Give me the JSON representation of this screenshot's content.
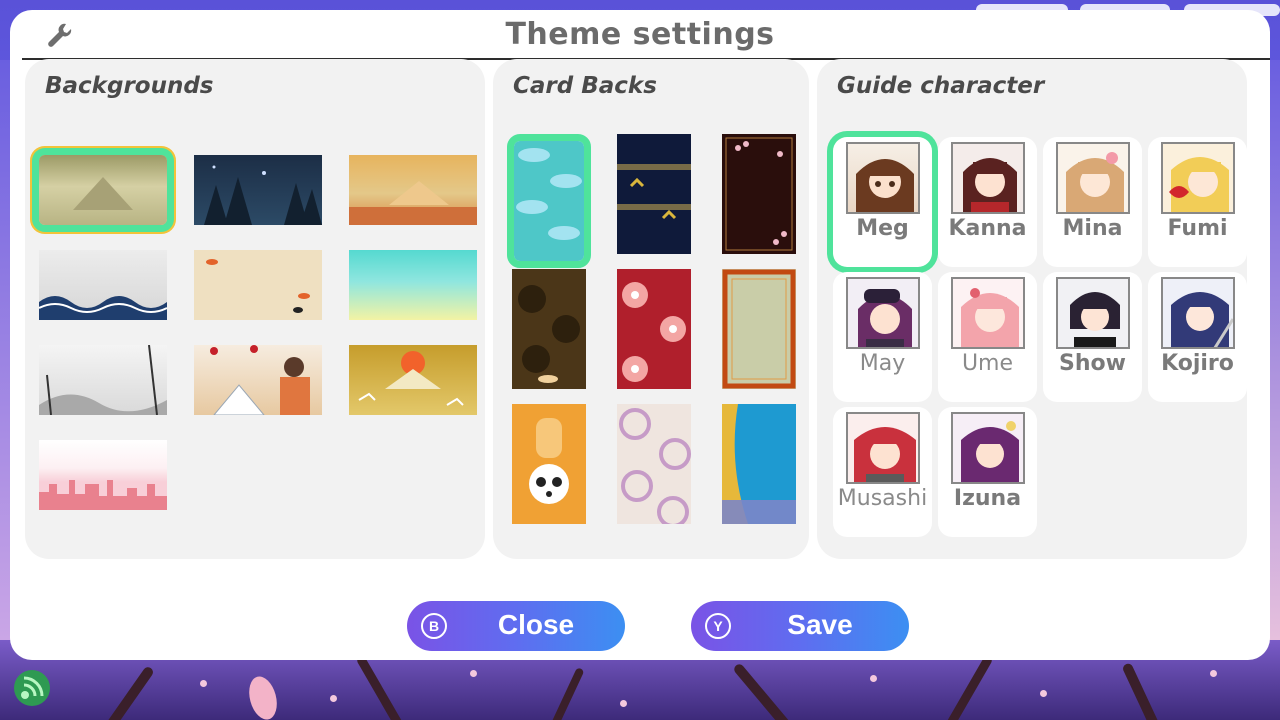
{
  "header": {
    "title": "Theme settings"
  },
  "sections": {
    "backgrounds": {
      "title": "Backgrounds",
      "selected_index": 0
    },
    "card_backs": {
      "title": "Card Backs",
      "selected_index": 0
    },
    "guide": {
      "title": "Guide character",
      "selected_index": 0
    }
  },
  "characters": [
    {
      "name": "Meg"
    },
    {
      "name": "Kanna"
    },
    {
      "name": "Mina"
    },
    {
      "name": "Fumi"
    },
    {
      "name": "May"
    },
    {
      "name": "Ume"
    },
    {
      "name": "Show"
    },
    {
      "name": "Kojiro"
    },
    {
      "name": "Musashi"
    },
    {
      "name": "Izuna"
    }
  ],
  "buttons": {
    "close": {
      "label": "Close",
      "glyph": "B"
    },
    "save": {
      "label": "Save",
      "glyph": "Y"
    }
  },
  "colors": {
    "selection": "#4fe39b",
    "button_gradient_start": "#7a53e6",
    "button_gradient_end": "#3c8ff2"
  }
}
